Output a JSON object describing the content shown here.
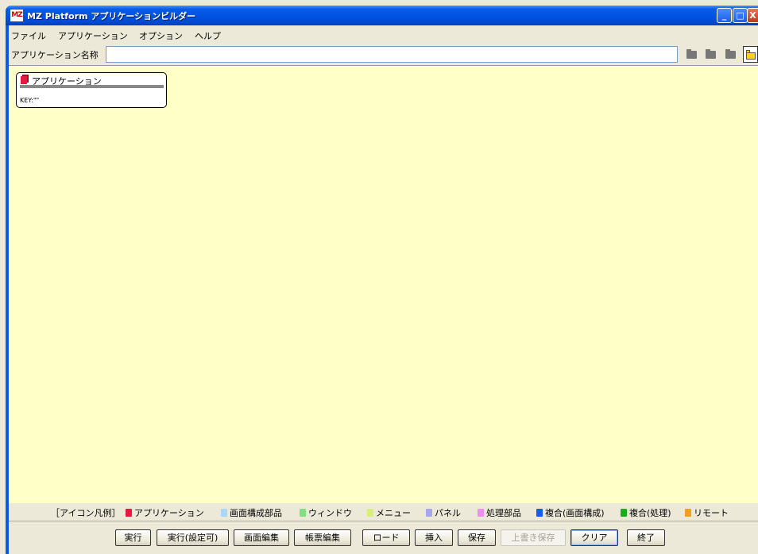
{
  "window": {
    "logo_text": "MZ",
    "title": "MZ Platform アプリケーションビルダー",
    "minimize_glyph": "_",
    "maximize_glyph": "□",
    "close_glyph": "X"
  },
  "menu": [
    "ファイル",
    "アプリケーション",
    "オプション",
    "ヘルプ"
  ],
  "app_name": {
    "label": "アプリケーション名称",
    "value": ""
  },
  "toolbar_icons": [
    "folder-icon",
    "folder-icon",
    "folder-icon",
    "open-folder-icon"
  ],
  "node": {
    "title": "アプリケーション",
    "key": "KEY:\"\""
  },
  "legend": {
    "label": "［アイコン凡例］",
    "items": [
      {
        "name": "アプリケーション",
        "color": "#e8183f"
      },
      {
        "name": "画面構成部品",
        "color": "#a9d8f5"
      },
      {
        "name": "ウィンドウ",
        "color": "#7fe07f"
      },
      {
        "name": "メニュー",
        "color": "#d8f07a"
      },
      {
        "name": "パネル",
        "color": "#a7a7f0"
      },
      {
        "name": "処理部品",
        "color": "#f08ef0"
      },
      {
        "name": "複合(画面構成)",
        "color": "#1060e0"
      },
      {
        "name": "複合(処理)",
        "color": "#18b018"
      },
      {
        "name": "リモート",
        "color": "#f0a020"
      }
    ]
  },
  "buttons": {
    "run": "実行",
    "run_config": "実行(設定可)",
    "screen_edit": "画面編集",
    "form_edit": "帳票編集",
    "load": "ロード",
    "insert": "挿入",
    "save": "保存",
    "overwrite_save": "上書き保存",
    "clear": "クリア",
    "exit": "終了"
  }
}
